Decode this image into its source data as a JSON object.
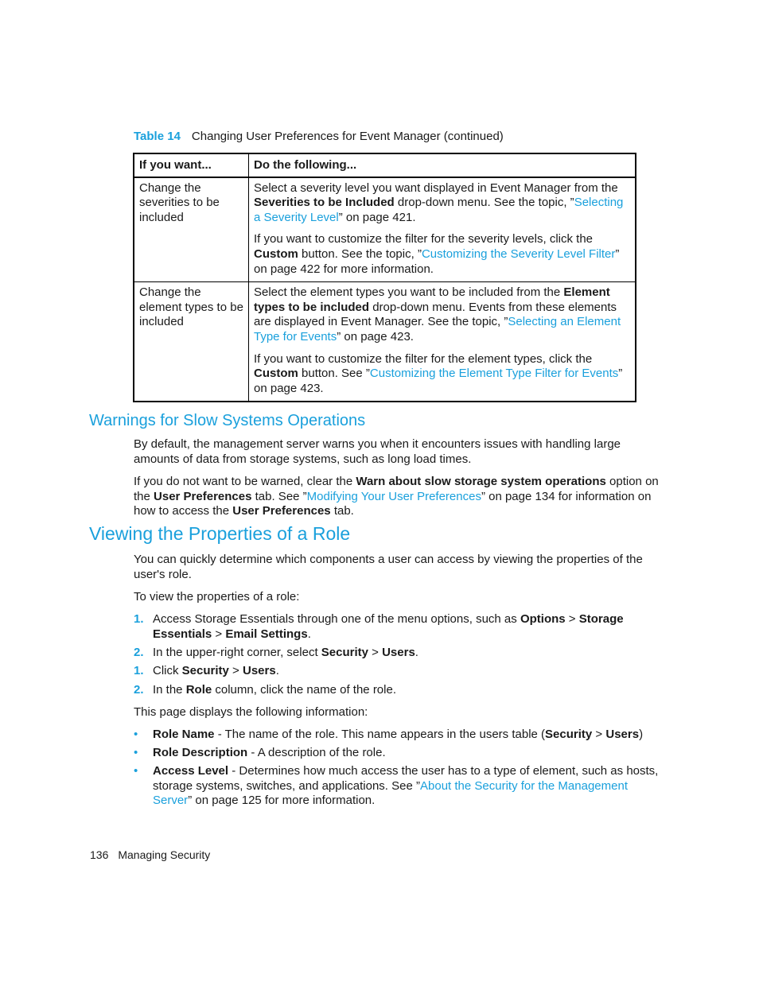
{
  "table": {
    "label": "Table 14",
    "caption": "Changing User Preferences for Event Manager (continued)",
    "headers": [
      "If you want...",
      "Do the following..."
    ],
    "rows": [
      {
        "want": "Change the severities to be included",
        "p1": {
          "t1": "Select a severity level you want displayed in Event Manager from the ",
          "b1": "Severities to be Included",
          "t2": " drop-down menu. See the topic, ”",
          "link": "Selecting a Severity Level",
          "t3": "” on page 421."
        },
        "p2": {
          "t1": "If you want to customize the filter for the severity levels, click the ",
          "b1": "Custom",
          "t2": " button. See the topic, ”",
          "link": "Customizing the Severity Level Filter",
          "t3": "” on page 422 for more information."
        }
      },
      {
        "want": "Change the element types to be included",
        "p1": {
          "t1": "Select the element types you want to be included from the ",
          "b1": "Element types to be included",
          "t2": " drop-down menu. Events from these elements are displayed in Event Manager. See the topic, ”",
          "link": "Selecting an Element Type for Events",
          "t3": "” on page 423."
        },
        "p2": {
          "t1": "If you want to customize the filter for the element types, click the ",
          "b1": "Custom",
          "t2": " button. See ”",
          "link": "Customizing the Element Type Filter for Events",
          "t3": "” on page 423."
        }
      }
    ]
  },
  "warnings": {
    "heading": "Warnings for Slow Systems Operations",
    "para1": "By default, the management server warns you when it encounters issues with handling large amounts of data from storage systems, such as long load times.",
    "para2": {
      "t1": "If you do not want to be warned, clear the ",
      "b1": "Warn about slow storage system operations",
      "t2": " option on the ",
      "b2": "User Preferences",
      "t3": " tab. See ”",
      "link": "Modifying Your User Preferences",
      "t4": "” on page 134 for information on how to access the ",
      "b3": "User Preferences",
      "t5": " tab."
    }
  },
  "role": {
    "heading": "Viewing the Properties of a Role",
    "intro": "You can quickly determine which components a user can access by viewing the properties of the user's role.",
    "lead": "To view the properties of a role:",
    "steps": [
      {
        "num": "1.",
        "t1": "Access Storage Essentials through one of the menu options, such as ",
        "b1": "Options",
        "s1": " > ",
        "b2": "Storage Essentials",
        "s2": " > ",
        "b3": "Email Settings",
        "t2": "."
      },
      {
        "num": "2.",
        "t1": "In the upper-right corner, select ",
        "b1": "Security",
        "s1": " > ",
        "b2": "Users",
        "t2": "."
      },
      {
        "num": "1.",
        "t1": "Click ",
        "b1": "Security",
        "s1": " > ",
        "b2": "Users",
        "t2": "."
      },
      {
        "num": "2.",
        "t1": "In the ",
        "b1": "Role",
        "t2": " column, click the name of the role."
      }
    ],
    "displays": "This page displays the following information:",
    "bullets": [
      {
        "b1": "Role Name",
        "t1": " - The name of the role. This name appears in the users table (",
        "b2": "Security",
        "s1": " > ",
        "b3": "Users",
        "t2": ")"
      },
      {
        "b1": "Role Description",
        "t1": " - A description of the role."
      },
      {
        "b1": "Access Level",
        "t1": " - Determines how much access the user has to a type of element, such as hosts, storage systems, switches, and applications. See ”",
        "link": "About the Security for the Management Server",
        "t2": "” on page 125 for more information."
      }
    ]
  },
  "footer": {
    "page_number": "136",
    "section": "Managing Security"
  }
}
